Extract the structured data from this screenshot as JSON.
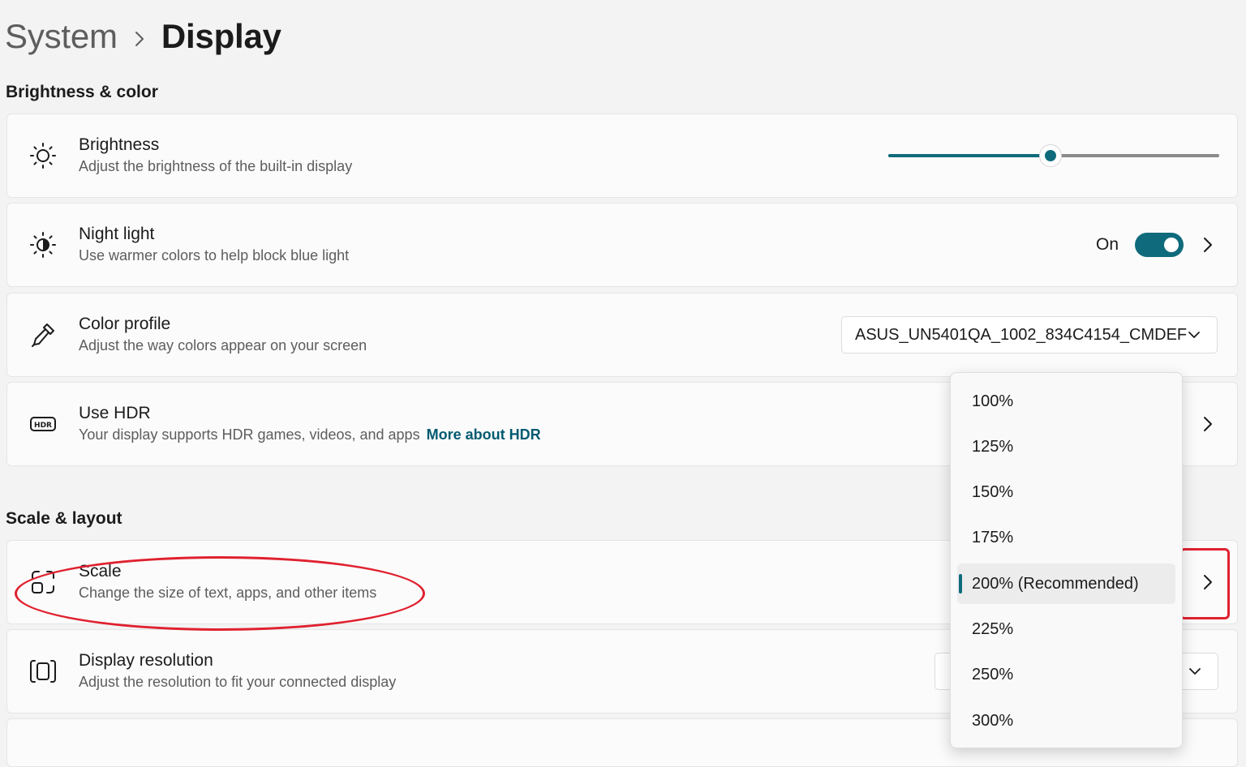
{
  "breadcrumb": {
    "parent": "System",
    "current": "Display"
  },
  "sections": {
    "brightness_color": "Brightness & color",
    "scale_layout": "Scale & layout"
  },
  "brightness": {
    "title": "Brightness",
    "description": "Adjust the brightness of the built-in display",
    "level_fraction": 0.49
  },
  "night_light": {
    "title": "Night light",
    "description": "Use warmer colors to help block blue light",
    "state": "On"
  },
  "color_profile": {
    "title": "Color profile",
    "description": "Adjust the way colors appear on your screen",
    "value": "ASUS_UN5401QA_1002_834C4154_CMDEF"
  },
  "hdr": {
    "title": "Use HDR",
    "description": "Your display supports HDR games, videos, and apps",
    "link": "More about HDR"
  },
  "scale": {
    "title": "Scale",
    "description": "Change the size of text, apps, and other items",
    "options": [
      "100%",
      "125%",
      "150%",
      "175%",
      "200% (Recommended)",
      "225%",
      "250%",
      "300%"
    ],
    "selected_index": 4
  },
  "display_resolution": {
    "title": "Display resolution",
    "description": "Adjust the resolution to fit your connected display"
  },
  "colors": {
    "accent": "#0f6b7c",
    "link": "#005a70",
    "annotation": "#e0212f"
  },
  "icons": {
    "brightness": "sun-icon",
    "night_light": "night-sun-icon",
    "color_profile": "eyedropper-icon",
    "hdr": "hdr-icon",
    "scale": "scale-icon",
    "resolution": "resolution-icon"
  }
}
